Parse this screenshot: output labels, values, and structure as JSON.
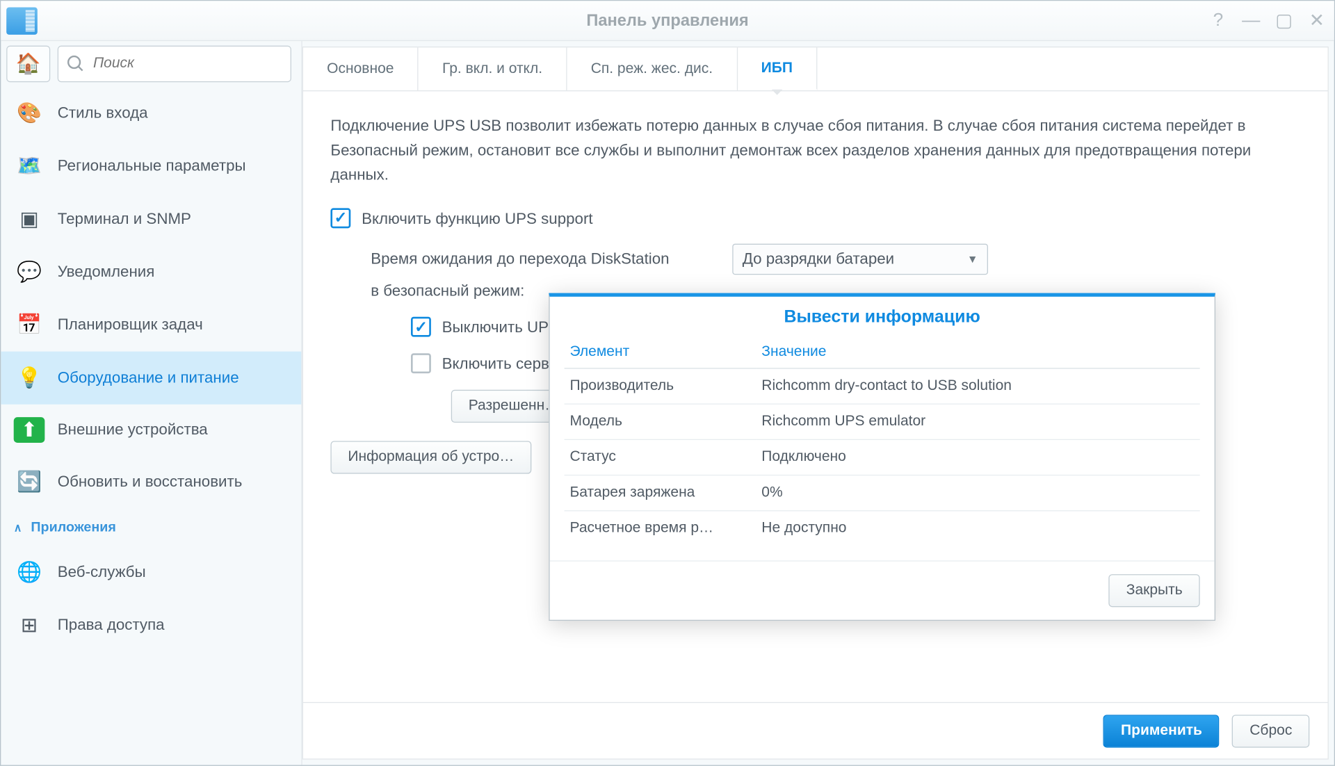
{
  "accent": "#0f8ae0",
  "window": {
    "title": "Панель управления"
  },
  "search": {
    "placeholder": "Поиск"
  },
  "sidebar": {
    "section_label": "Приложения",
    "items": [
      {
        "label": "Стиль входа",
        "icon": "🎨",
        "style": "color:#19bdd0"
      },
      {
        "label": "Региональные параметры",
        "icon": "🗺️",
        "style": ""
      },
      {
        "label": "Терминал и SNMP",
        "icon": "▣",
        "style": "color:#4c5a63"
      },
      {
        "label": "Уведомления",
        "icon": "💬",
        "style": "color:#22c24b"
      },
      {
        "label": "Планировщик задач",
        "icon": "📅",
        "style": "color:#e23b3b"
      },
      {
        "label": "Оборудование и питание",
        "icon": "💡",
        "style": "color:#f6b62b",
        "active": true
      },
      {
        "label": "Внешние устройства",
        "icon": "⬆",
        "style": "background:#22b34a;color:#fff;border-radius:4px;width:30px;height:28px"
      },
      {
        "label": "Обновить и восстановить",
        "icon": "🔄",
        "style": "color:#18a849"
      },
      {
        "label": "Веб-службы",
        "icon": "🌐",
        "style": "color:#3f4b55",
        "after_section": true
      },
      {
        "label": "Права доступа",
        "icon": "⊞",
        "style": ""
      }
    ]
  },
  "tabs": [
    {
      "label": "Основное"
    },
    {
      "label": "Гр. вкл. и откл."
    },
    {
      "label": "Сп. реж. жес. дис."
    },
    {
      "label": "ИБП",
      "active": true
    }
  ],
  "content": {
    "description": "Подключение UPS USB позволит избежать потерю данных в случае сбоя питания. В случае сбоя питания система перейдет в Безопасный режим, остановит все службы и выполнит демонтаж всех разделов хранения данных для предотвращения потери данных.",
    "enable_ups_label": "Включить функцию UPS support",
    "wait_label_1": "Время ожидания до перехода DiskStation",
    "wait_label_2": "в безопасный режим:",
    "wait_select_value": "До разрядки батареи",
    "shutdown_label": "Выключить UPS",
    "enable_server_label": "Включить сервер",
    "allowed_button": "Разрешенн…",
    "device_info_button": "Информация об устро…"
  },
  "footer": {
    "apply": "Применить",
    "reset": "Сброс"
  },
  "dialog": {
    "title": "Вывести информацию",
    "close": "Закрыть",
    "columns": {
      "key": "Элемент",
      "value": "Значение"
    },
    "rows": [
      {
        "k": "Производитель",
        "v": "Richcomm dry-contact to USB solution"
      },
      {
        "k": "Модель",
        "v": "Richcomm UPS emulator"
      },
      {
        "k": "Статус",
        "v": "Подключено"
      },
      {
        "k": "Батарея заряжена",
        "v": "0%"
      },
      {
        "k": "Расчетное время р…",
        "v": "Не доступно"
      }
    ]
  }
}
